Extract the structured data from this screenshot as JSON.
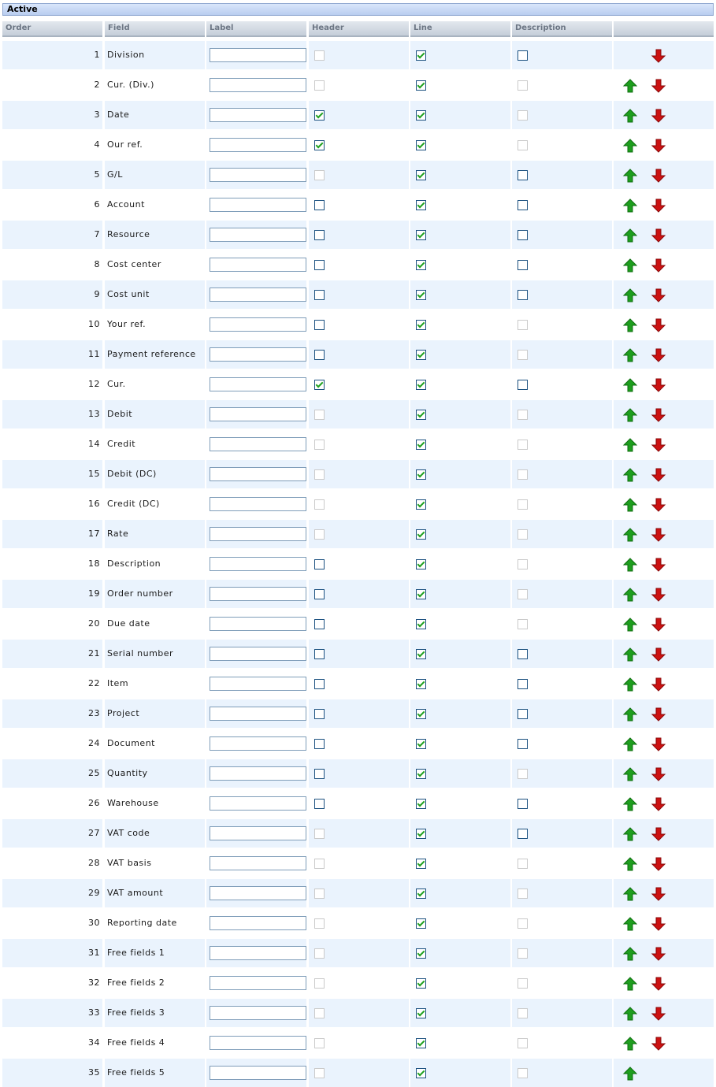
{
  "section": {
    "title": "Active"
  },
  "columns": {
    "order": "Order",
    "field": "Field",
    "label": "Label",
    "header": "Header",
    "line": "Line",
    "description": "Description",
    "move": ""
  },
  "colors": {
    "up_arrow": "#1e9e1e",
    "down_arrow": "#cc1111",
    "row_alt": "#eaf3fd"
  },
  "icons": {
    "up": "arrow-up-icon",
    "down": "arrow-down-icon"
  },
  "rows": [
    {
      "order": "1",
      "field": "Division",
      "label": "",
      "header": {
        "checked": false,
        "enabled": false
      },
      "line": {
        "checked": true,
        "enabled": true
      },
      "description": {
        "checked": false,
        "enabled": true
      },
      "up": false,
      "down": true
    },
    {
      "order": "2",
      "field": "Cur. (Div.)",
      "label": "",
      "header": {
        "checked": false,
        "enabled": false
      },
      "line": {
        "checked": true,
        "enabled": true
      },
      "description": {
        "checked": false,
        "enabled": false
      },
      "up": true,
      "down": true
    },
    {
      "order": "3",
      "field": "Date",
      "label": "",
      "header": {
        "checked": true,
        "enabled": true
      },
      "line": {
        "checked": true,
        "enabled": true
      },
      "description": {
        "checked": false,
        "enabled": false
      },
      "up": true,
      "down": true
    },
    {
      "order": "4",
      "field": "Our ref.",
      "label": "",
      "header": {
        "checked": true,
        "enabled": true
      },
      "line": {
        "checked": true,
        "enabled": true
      },
      "description": {
        "checked": false,
        "enabled": false
      },
      "up": true,
      "down": true
    },
    {
      "order": "5",
      "field": "G/L",
      "label": "",
      "header": {
        "checked": false,
        "enabled": false
      },
      "line": {
        "checked": true,
        "enabled": true
      },
      "description": {
        "checked": false,
        "enabled": true
      },
      "up": true,
      "down": true
    },
    {
      "order": "6",
      "field": "Account",
      "label": "",
      "header": {
        "checked": false,
        "enabled": true
      },
      "line": {
        "checked": true,
        "enabled": true
      },
      "description": {
        "checked": false,
        "enabled": true
      },
      "up": true,
      "down": true
    },
    {
      "order": "7",
      "field": "Resource",
      "label": "",
      "header": {
        "checked": false,
        "enabled": true
      },
      "line": {
        "checked": true,
        "enabled": true
      },
      "description": {
        "checked": false,
        "enabled": true
      },
      "up": true,
      "down": true
    },
    {
      "order": "8",
      "field": "Cost center",
      "label": "",
      "header": {
        "checked": false,
        "enabled": true
      },
      "line": {
        "checked": true,
        "enabled": true
      },
      "description": {
        "checked": false,
        "enabled": true
      },
      "up": true,
      "down": true
    },
    {
      "order": "9",
      "field": "Cost unit",
      "label": "",
      "header": {
        "checked": false,
        "enabled": true
      },
      "line": {
        "checked": true,
        "enabled": true
      },
      "description": {
        "checked": false,
        "enabled": true
      },
      "up": true,
      "down": true
    },
    {
      "order": "10",
      "field": "Your ref.",
      "label": "",
      "header": {
        "checked": false,
        "enabled": true
      },
      "line": {
        "checked": true,
        "enabled": true
      },
      "description": {
        "checked": false,
        "enabled": false
      },
      "up": true,
      "down": true
    },
    {
      "order": "11",
      "field": "Payment reference",
      "label": "",
      "header": {
        "checked": false,
        "enabled": true
      },
      "line": {
        "checked": true,
        "enabled": true
      },
      "description": {
        "checked": false,
        "enabled": false
      },
      "up": true,
      "down": true
    },
    {
      "order": "12",
      "field": "Cur.",
      "label": "",
      "header": {
        "checked": true,
        "enabled": true
      },
      "line": {
        "checked": true,
        "enabled": true
      },
      "description": {
        "checked": false,
        "enabled": true
      },
      "up": true,
      "down": true
    },
    {
      "order": "13",
      "field": "Debit",
      "label": "",
      "header": {
        "checked": false,
        "enabled": false
      },
      "line": {
        "checked": true,
        "enabled": true
      },
      "description": {
        "checked": false,
        "enabled": false
      },
      "up": true,
      "down": true
    },
    {
      "order": "14",
      "field": "Credit",
      "label": "",
      "header": {
        "checked": false,
        "enabled": false
      },
      "line": {
        "checked": true,
        "enabled": true
      },
      "description": {
        "checked": false,
        "enabled": false
      },
      "up": true,
      "down": true
    },
    {
      "order": "15",
      "field": "Debit (DC)",
      "label": "",
      "header": {
        "checked": false,
        "enabled": false
      },
      "line": {
        "checked": true,
        "enabled": true
      },
      "description": {
        "checked": false,
        "enabled": false
      },
      "up": true,
      "down": true
    },
    {
      "order": "16",
      "field": "Credit (DC)",
      "label": "",
      "header": {
        "checked": false,
        "enabled": false
      },
      "line": {
        "checked": true,
        "enabled": true
      },
      "description": {
        "checked": false,
        "enabled": false
      },
      "up": true,
      "down": true
    },
    {
      "order": "17",
      "field": "Rate",
      "label": "",
      "header": {
        "checked": false,
        "enabled": false
      },
      "line": {
        "checked": true,
        "enabled": true
      },
      "description": {
        "checked": false,
        "enabled": false
      },
      "up": true,
      "down": true
    },
    {
      "order": "18",
      "field": "Description",
      "label": "",
      "header": {
        "checked": false,
        "enabled": true
      },
      "line": {
        "checked": true,
        "enabled": true
      },
      "description": {
        "checked": false,
        "enabled": false
      },
      "up": true,
      "down": true
    },
    {
      "order": "19",
      "field": "Order number",
      "label": "",
      "header": {
        "checked": false,
        "enabled": true
      },
      "line": {
        "checked": true,
        "enabled": true
      },
      "description": {
        "checked": false,
        "enabled": false
      },
      "up": true,
      "down": true
    },
    {
      "order": "20",
      "field": "Due date",
      "label": "",
      "header": {
        "checked": false,
        "enabled": true
      },
      "line": {
        "checked": true,
        "enabled": true
      },
      "description": {
        "checked": false,
        "enabled": false
      },
      "up": true,
      "down": true
    },
    {
      "order": "21",
      "field": "Serial number",
      "label": "",
      "header": {
        "checked": false,
        "enabled": true
      },
      "line": {
        "checked": true,
        "enabled": true
      },
      "description": {
        "checked": false,
        "enabled": true
      },
      "up": true,
      "down": true
    },
    {
      "order": "22",
      "field": "Item",
      "label": "",
      "header": {
        "checked": false,
        "enabled": true
      },
      "line": {
        "checked": true,
        "enabled": true
      },
      "description": {
        "checked": false,
        "enabled": true
      },
      "up": true,
      "down": true
    },
    {
      "order": "23",
      "field": "Project",
      "label": "",
      "header": {
        "checked": false,
        "enabled": true
      },
      "line": {
        "checked": true,
        "enabled": true
      },
      "description": {
        "checked": false,
        "enabled": true
      },
      "up": true,
      "down": true
    },
    {
      "order": "24",
      "field": "Document",
      "label": "",
      "header": {
        "checked": false,
        "enabled": true
      },
      "line": {
        "checked": true,
        "enabled": true
      },
      "description": {
        "checked": false,
        "enabled": true
      },
      "up": true,
      "down": true
    },
    {
      "order": "25",
      "field": "Quantity",
      "label": "",
      "header": {
        "checked": false,
        "enabled": true
      },
      "line": {
        "checked": true,
        "enabled": true
      },
      "description": {
        "checked": false,
        "enabled": false
      },
      "up": true,
      "down": true
    },
    {
      "order": "26",
      "field": "Warehouse",
      "label": "",
      "header": {
        "checked": false,
        "enabled": true
      },
      "line": {
        "checked": true,
        "enabled": true
      },
      "description": {
        "checked": false,
        "enabled": true
      },
      "up": true,
      "down": true
    },
    {
      "order": "27",
      "field": "VAT code",
      "label": "",
      "header": {
        "checked": false,
        "enabled": false
      },
      "line": {
        "checked": true,
        "enabled": true
      },
      "description": {
        "checked": false,
        "enabled": true
      },
      "up": true,
      "down": true
    },
    {
      "order": "28",
      "field": "VAT basis",
      "label": "",
      "header": {
        "checked": false,
        "enabled": false
      },
      "line": {
        "checked": true,
        "enabled": true
      },
      "description": {
        "checked": false,
        "enabled": false
      },
      "up": true,
      "down": true
    },
    {
      "order": "29",
      "field": "VAT amount",
      "label": "",
      "header": {
        "checked": false,
        "enabled": false
      },
      "line": {
        "checked": true,
        "enabled": true
      },
      "description": {
        "checked": false,
        "enabled": false
      },
      "up": true,
      "down": true
    },
    {
      "order": "30",
      "field": "Reporting date",
      "label": "",
      "header": {
        "checked": false,
        "enabled": false
      },
      "line": {
        "checked": true,
        "enabled": true
      },
      "description": {
        "checked": false,
        "enabled": false
      },
      "up": true,
      "down": true
    },
    {
      "order": "31",
      "field": "Free fields 1",
      "label": "",
      "header": {
        "checked": false,
        "enabled": false
      },
      "line": {
        "checked": true,
        "enabled": true
      },
      "description": {
        "checked": false,
        "enabled": false
      },
      "up": true,
      "down": true
    },
    {
      "order": "32",
      "field": "Free fields 2",
      "label": "",
      "header": {
        "checked": false,
        "enabled": false
      },
      "line": {
        "checked": true,
        "enabled": true
      },
      "description": {
        "checked": false,
        "enabled": false
      },
      "up": true,
      "down": true
    },
    {
      "order": "33",
      "field": "Free fields 3",
      "label": "",
      "header": {
        "checked": false,
        "enabled": false
      },
      "line": {
        "checked": true,
        "enabled": true
      },
      "description": {
        "checked": false,
        "enabled": false
      },
      "up": true,
      "down": true
    },
    {
      "order": "34",
      "field": "Free fields 4",
      "label": "",
      "header": {
        "checked": false,
        "enabled": false
      },
      "line": {
        "checked": true,
        "enabled": true
      },
      "description": {
        "checked": false,
        "enabled": false
      },
      "up": true,
      "down": true
    },
    {
      "order": "35",
      "field": "Free fields 5",
      "label": "",
      "header": {
        "checked": false,
        "enabled": false
      },
      "line": {
        "checked": true,
        "enabled": true
      },
      "description": {
        "checked": false,
        "enabled": false
      },
      "up": true,
      "down": false
    }
  ]
}
